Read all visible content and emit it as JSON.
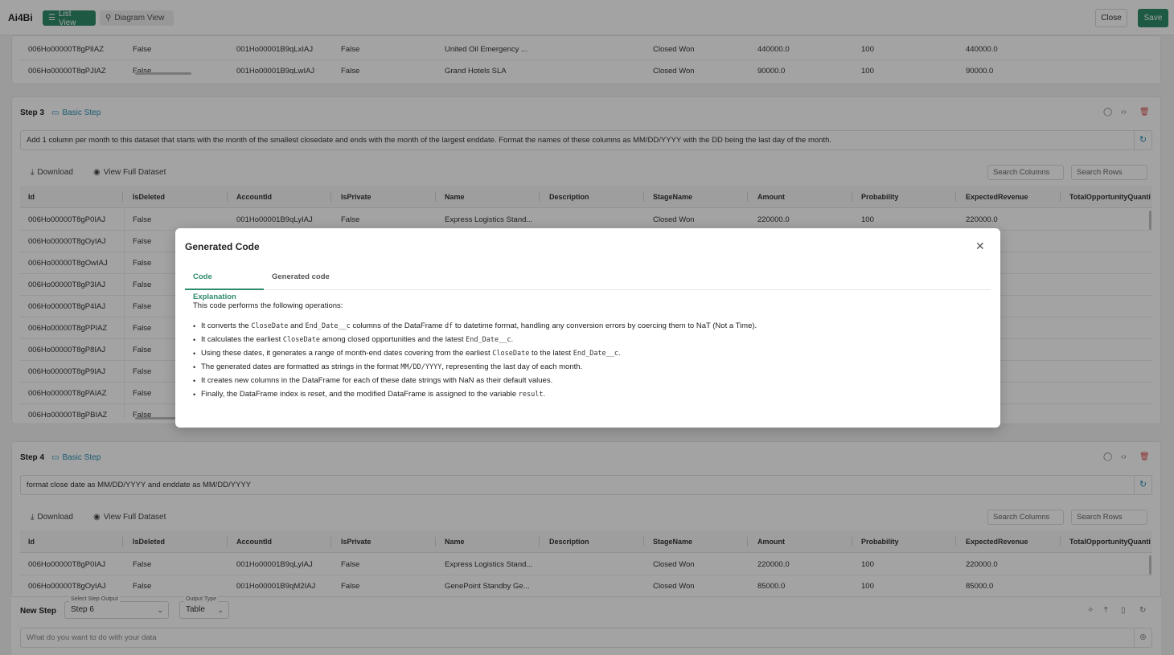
{
  "app": {
    "logo": "Ai4Bi"
  },
  "topbar": {
    "list_view": "List View",
    "diagram_view": "Diagram View",
    "close": "Close",
    "save": "Save"
  },
  "step2_partial": {
    "rows": [
      [
        "006Ho00000T8gPlIAZ",
        "False",
        "001Ho00001B9qLxIAJ",
        "False",
        "United Oil Emergency ...",
        "",
        "Closed Won",
        "440000.0",
        "100",
        "440000.0"
      ],
      [
        "006Ho00000T8gPJIAZ",
        "False",
        "001Ho00001B9qLwIAJ",
        "False",
        "Grand Hotels SLA",
        "",
        "Closed Won",
        "90000.0",
        "100",
        "90000.0"
      ]
    ]
  },
  "step3": {
    "title": "Step 3",
    "type": "Basic Step",
    "prompt": "Add 1 column per month to this dataset that starts with the month of the smallest closedate and ends with the month of the largest enddate. Format the names of these columns as MM/DD/YYYY with the DD being the last day of the month.",
    "download": "Download",
    "view_full": "View Full Dataset",
    "search_columns": "Search Columns",
    "search_rows": "Search Rows",
    "columns": [
      "Id",
      "IsDeleted",
      "AccountId",
      "IsPrivate",
      "Name",
      "Description",
      "StageName",
      "Amount",
      "Probability",
      "ExpectedRevenue",
      "TotalOpportunityQuanti"
    ],
    "rows": [
      [
        "006Ho00000T8gP0IAJ",
        "False",
        "001Ho00001B9qLyIAJ",
        "False",
        "Express Logistics Stand...",
        "",
        "Closed Won",
        "220000.0",
        "100",
        "220000.0"
      ],
      [
        "006Ho00000T8gOyIAJ",
        "False"
      ],
      [
        "006Ho00000T8gOwIAJ",
        "False"
      ],
      [
        "006Ho00000T8gP3IAJ",
        "False"
      ],
      [
        "006Ho00000T8gP4IAJ",
        "False"
      ],
      [
        "006Ho00000T8gPPIAZ",
        "False"
      ],
      [
        "006Ho00000T8gP8IAJ",
        "False"
      ],
      [
        "006Ho00000T8gP9IAJ",
        "False"
      ],
      [
        "006Ho00000T8gPAIAZ",
        "False"
      ],
      [
        "006Ho00000T8gPBIAZ",
        "False"
      ]
    ]
  },
  "step4": {
    "title": "Step 4",
    "type": "Basic Step",
    "prompt": "format close date as MM/DD/YYYY and enddate as MM/DD/YYYY",
    "download": "Download",
    "view_full": "View Full Dataset",
    "search_columns": "Search Columns",
    "search_rows": "Search Rows",
    "columns": [
      "Id",
      "IsDeleted",
      "AccountId",
      "IsPrivate",
      "Name",
      "Description",
      "StageName",
      "Amount",
      "Probability",
      "ExpectedRevenue",
      "TotalOpportunityQuanti"
    ],
    "rows": [
      [
        "006Ho00000T8gP0IAJ",
        "False",
        "001Ho00001B9qLyIAJ",
        "False",
        "Express Logistics Stand...",
        "",
        "Closed Won",
        "220000.0",
        "100",
        "220000.0"
      ],
      [
        "006Ho00000T8gOyIAJ",
        "False",
        "001Ho00001B9qM2IAJ",
        "False",
        "GenePoint Standby Ge...",
        "",
        "Closed Won",
        "85000.0",
        "100",
        "85000.0"
      ]
    ]
  },
  "new_step": {
    "label": "New Step",
    "select_output_label": "Select Step Output",
    "select_output_value": "Step 6",
    "output_type_label": "Output Type",
    "output_type_value": "Table",
    "placeholder": "What do you want to do with your data"
  },
  "modal": {
    "title": "Generated Code",
    "tab_explanation": "Code Explanation",
    "tab_code": "Generated code",
    "intro": "This code performs the following operations:",
    "b1": {
      "t1": "It converts the",
      "c1": "CloseDate",
      "t2": "and",
      "c2": "End_Date__c",
      "t3": "columns of the DataFrame",
      "c3": "df",
      "t4": "to datetime format, handling any conversion errors by coercing them to NaT (Not a Time)."
    },
    "b2": {
      "t1": "It calculates the earliest",
      "c1": "CloseDate",
      "t2": "among closed opportunities and the latest",
      "c2": "End_Date__c",
      "t3": "."
    },
    "b3": {
      "t1": "Using these dates, it generates a range of month-end dates covering from the earliest",
      "c1": "CloseDate",
      "t2": "to the latest",
      "c2": "End_Date__c",
      "t3": "."
    },
    "b4": {
      "t1": "The generated dates are formatted as strings in the format",
      "c1": "MM/DD/YYYY",
      "t2": ", representing the last day of each month."
    },
    "b5": {
      "t1": "It creates new columns in the DataFrame for each of these date strings with NaN as their default values."
    },
    "b6": {
      "t1": "Finally, the DataFrame index is reset, and the modified DataFrame is assigned to the variable",
      "c1": "result",
      "t2": "."
    }
  }
}
